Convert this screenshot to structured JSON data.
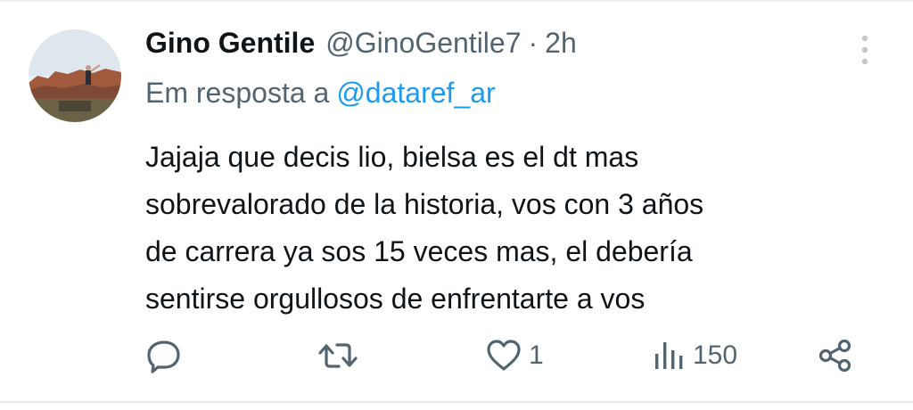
{
  "colors": {
    "text_primary": "#0f1419",
    "text_secondary": "#536471",
    "link": "#1d9bf0",
    "icon": "#536471"
  },
  "tweet": {
    "author_name": "Gino Gentile",
    "author_handle": "@GinoGentile7",
    "separator": "·",
    "time": "2h",
    "reply_prefix": "Em resposta a",
    "reply_to": "@dataref_ar",
    "text_lines": [
      "Jajaja que decis lio, bielsa es el dt mas",
      "sobrevalorado de la historia, vos con 3 años",
      "de carrera ya sos 15 veces mas, el debería",
      "sentirse orgullosos de enfrentarte a vos"
    ]
  },
  "actions": {
    "reply": {
      "icon": "reply-icon"
    },
    "retweet": {
      "icon": "retweet-icon"
    },
    "like": {
      "icon": "heart-icon",
      "count": "1"
    },
    "views": {
      "icon": "views-icon",
      "count": "150"
    },
    "share": {
      "icon": "share-icon"
    }
  }
}
